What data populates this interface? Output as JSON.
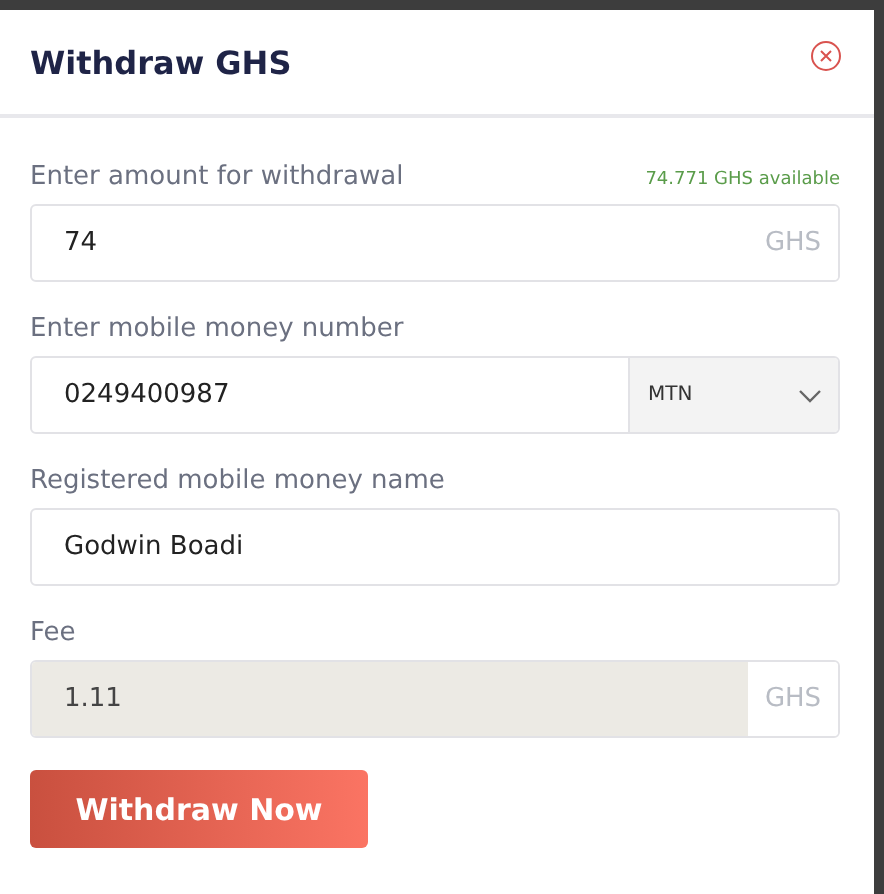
{
  "dialog": {
    "title": "Withdraw GHS"
  },
  "fields": [
    {
      "kind": "amount",
      "label": "Enter amount for withdrawal",
      "hint": "74.771 GHS available",
      "value": "74",
      "suffix": "GHS",
      "disabled": false
    },
    {
      "kind": "phone",
      "label": "Enter mobile money number",
      "value": "0249400987",
      "network": "MTN",
      "disabled": false
    },
    {
      "kind": "text",
      "label": "Registered mobile money name",
      "value": "Godwin Boadi",
      "disabled": false
    },
    {
      "kind": "amount",
      "label": "Fee",
      "value": "1.11",
      "suffix": "GHS",
      "disabled": true
    }
  ],
  "submit": "Withdraw Now"
}
